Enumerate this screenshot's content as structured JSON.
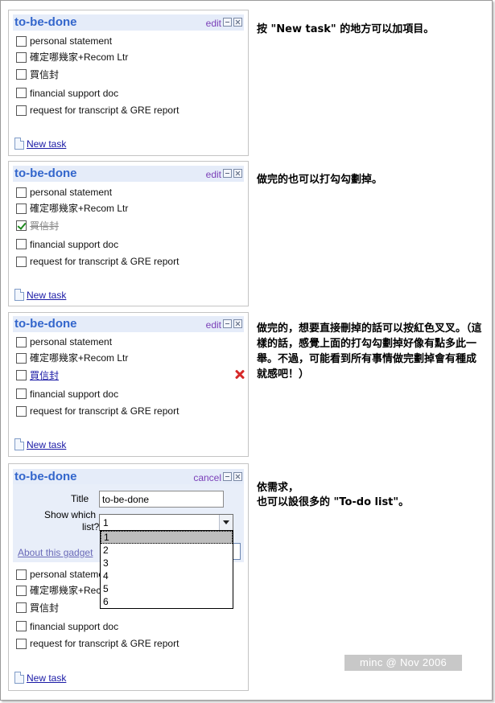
{
  "gadgets": [
    {
      "title": "to-be-done",
      "action_label": "edit",
      "tasks": [
        {
          "label": "personal statement",
          "checked": false
        },
        {
          "label": "確定哪幾家+Recom Ltr",
          "checked": false
        },
        {
          "label": "買信封",
          "checked": false
        },
        {
          "label": "financial support doc",
          "checked": false
        },
        {
          "label": "request for transcript & GRE report",
          "checked": false
        }
      ],
      "new_task_label": "New task"
    },
    {
      "title": "to-be-done",
      "action_label": "edit",
      "tasks": [
        {
          "label": "personal statement",
          "checked": false
        },
        {
          "label": "確定哪幾家+Recom Ltr",
          "checked": false
        },
        {
          "label": "買信封",
          "checked": true
        },
        {
          "label": "financial support doc",
          "checked": false
        },
        {
          "label": "request for transcript & GRE report",
          "checked": false
        }
      ],
      "new_task_label": "New task"
    },
    {
      "title": "to-be-done",
      "action_label": "edit",
      "tasks": [
        {
          "label": "personal statement",
          "checked": false
        },
        {
          "label": "確定哪幾家+Recom Ltr",
          "checked": false
        },
        {
          "label": "買信封",
          "checked": false
        },
        {
          "label": "financial support doc",
          "checked": false
        },
        {
          "label": "request for transcript & GRE report",
          "checked": false
        }
      ],
      "new_task_label": "New task"
    },
    {
      "title": "to-be-done",
      "action_label": "cancel",
      "settings": {
        "title_label": "Title",
        "title_value": "to-be-done",
        "show_label_line1": "Show which",
        "show_label_line2": "list?",
        "selected": "1",
        "options": [
          "1",
          "2",
          "3",
          "4",
          "5",
          "6"
        ],
        "about_link": "About this gadget"
      },
      "tasks": [
        {
          "label": "personal statement",
          "checked": false
        },
        {
          "label": "確定哪幾家+Recom Ltr",
          "checked": false
        },
        {
          "label": "買信封",
          "checked": false
        },
        {
          "label": "financial support doc",
          "checked": false
        },
        {
          "label": "request for transcript & GRE report",
          "checked": false
        }
      ],
      "new_task_label": "New task"
    }
  ],
  "annotations": [
    "按 \"New task\" 的地方可以加項目。",
    "做完的也可以打勾勾劃掉。",
    "做完的，想要直接刪掉的話可以按紅色叉叉。（這樣的話，感覺上面的打勾勾劃掉好像有點多此一舉。不過，可能看到所有事情做完劃掉會有種成就感吧！）",
    "依需求，",
    "也可以設很多的 \"To-do list\"。"
  ],
  "watermark": "minc @ Nov 2006",
  "colors": {
    "title": "#3366cc",
    "titlebar_bg": "#e5ecf9",
    "link": "#1a1aa6",
    "delete": "#d62a2a",
    "check": "#1d8a1d"
  }
}
